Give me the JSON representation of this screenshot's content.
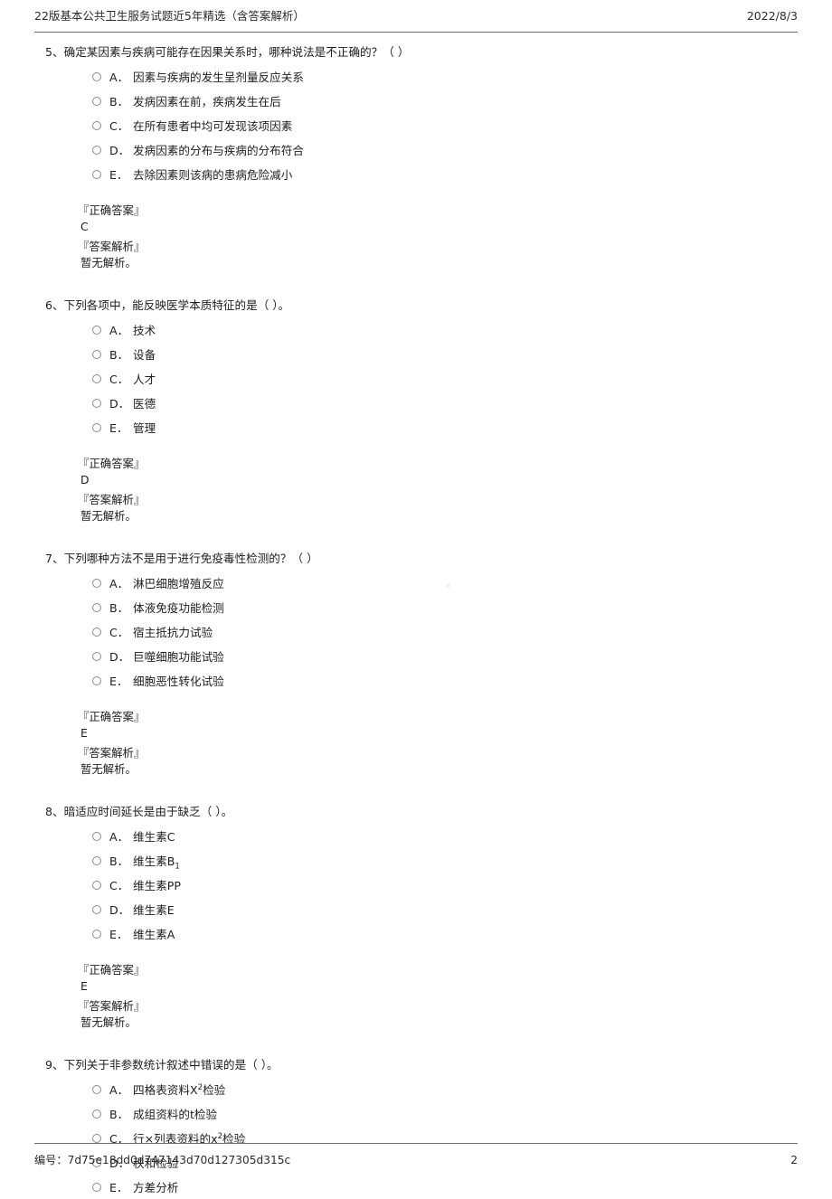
{
  "header": {
    "title": "22版基本公共卫生服务试题近5年精选（含答案解析）",
    "date": "2022/8/3"
  },
  "footer": {
    "serial_label": "编号：",
    "serial_value": "7d75e18dd0d747143d70d127305d315c",
    "page_number": "2"
  },
  "labels": {
    "correct_answer": "『正确答案』",
    "answer_analysis": "『答案解析』",
    "no_analysis": "暂无解析。"
  },
  "questions": [
    {
      "number": "5、",
      "stem": "确定某因素与疾病可能存在因果关系时，哪种说法是不正确的？（     ）",
      "options": [
        {
          "letter": "A．",
          "text": "因素与疾病的发生呈剂量反应关系"
        },
        {
          "letter": "B．",
          "text": "发病因素在前，疾病发生在后"
        },
        {
          "letter": "C．",
          "text": "在所有患者中均可发现该项因素"
        },
        {
          "letter": "D．",
          "text": "发病因素的分布与疾病的分布符合"
        },
        {
          "letter": "E．",
          "text": "去除因素则该病的患病危险减小"
        }
      ],
      "answer": "C",
      "analysis": "暂无解析。"
    },
    {
      "number": "6、",
      "stem": "下列各项中，能反映医学本质特征的是（     ）。",
      "options": [
        {
          "letter": "A．",
          "text": "技术"
        },
        {
          "letter": "B．",
          "text": "设备"
        },
        {
          "letter": "C．",
          "text": "人才"
        },
        {
          "letter": "D．",
          "text": "医德"
        },
        {
          "letter": "E．",
          "text": "管理"
        }
      ],
      "answer": "D",
      "analysis": "暂无解析。"
    },
    {
      "number": "7、",
      "stem": "下列哪种方法不是用于进行免疫毒性检测的？（     ）",
      "options": [
        {
          "letter": "A．",
          "text": "淋巴细胞增殖反应"
        },
        {
          "letter": "B．",
          "text": "体液免疫功能检测"
        },
        {
          "letter": "C．",
          "text": "宿主抵抗力试验"
        },
        {
          "letter": "D．",
          "text": "巨噬细胞功能试验"
        },
        {
          "letter": "E．",
          "text": "细胞恶性转化试验"
        }
      ],
      "answer": "E",
      "analysis": "暂无解析。"
    },
    {
      "number": "8、",
      "stem": "暗适应时间延长是由于缺乏（     ）。",
      "options": [
        {
          "letter": "A．",
          "text": "维生素C"
        },
        {
          "letter": "B．",
          "text": "维生素B",
          "sub": "1"
        },
        {
          "letter": "C．",
          "text": "维生素PP"
        },
        {
          "letter": "D．",
          "text": "维生素E"
        },
        {
          "letter": "E．",
          "text": "维生素A"
        }
      ],
      "answer": "E",
      "analysis": "暂无解析。"
    },
    {
      "number": "9、",
      "stem": "下列关于非参数统计叙述中错误的是（     ）。",
      "options": [
        {
          "letter": "A．",
          "text": "四格表资料X",
          "sup": "2",
          "text_after": "检验"
        },
        {
          "letter": "B．",
          "text": "成组资料的t检验"
        },
        {
          "letter": "C．",
          "text": "行×列表资料的x",
          "sup": "2",
          "text_after": "检验"
        },
        {
          "letter": "D．",
          "text": "秩和检验"
        },
        {
          "letter": "E．",
          "text": "方差分析"
        }
      ]
    }
  ]
}
